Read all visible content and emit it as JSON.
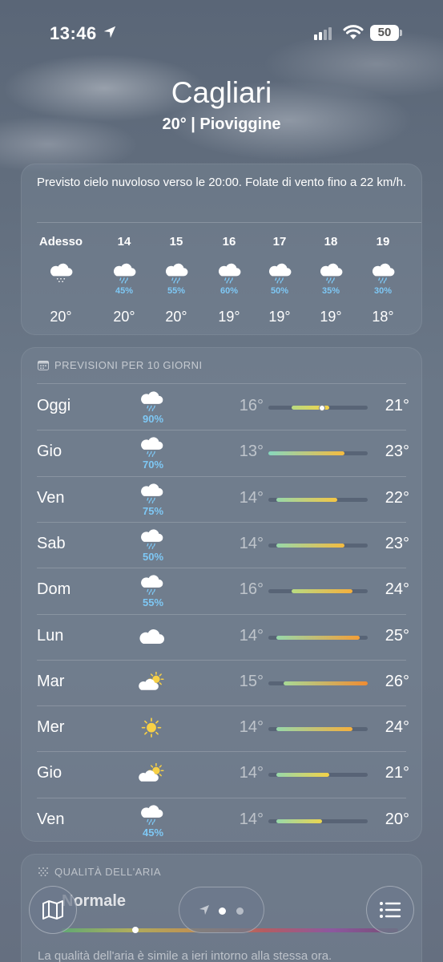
{
  "status": {
    "time": "13:46",
    "battery": "50"
  },
  "header": {
    "city": "Cagliari",
    "summary": "20°  |  Pioviggine"
  },
  "hourly": {
    "description": "Previsto cielo nuvoloso verso le 20:00. Folate di vento fino a 22 km/h.",
    "items": [
      {
        "label": "Adesso",
        "icon": "cloud-drizzle-icon",
        "pct": "",
        "temp": "20°"
      },
      {
        "label": "14",
        "icon": "cloud-rain-icon",
        "pct": "45%",
        "temp": "20°"
      },
      {
        "label": "15",
        "icon": "cloud-rain-icon",
        "pct": "55%",
        "temp": "20°"
      },
      {
        "label": "16",
        "icon": "cloud-rain-icon",
        "pct": "60%",
        "temp": "19°"
      },
      {
        "label": "17",
        "icon": "cloud-rain-icon",
        "pct": "50%",
        "temp": "19°"
      },
      {
        "label": "18",
        "icon": "cloud-rain-icon",
        "pct": "35%",
        "temp": "19°"
      },
      {
        "label": "19",
        "icon": "cloud-rain-icon",
        "pct": "30%",
        "temp": "18°"
      }
    ]
  },
  "daily": {
    "title": "PREVISIONI PER 10 GIORNI",
    "range": {
      "min": 13,
      "max": 26
    },
    "days": [
      {
        "name": "Oggi",
        "icon": "cloud-rain-icon",
        "pct": "90%",
        "min": "16°",
        "max": "21°",
        "lo": 16,
        "hi": 21,
        "current": 20
      },
      {
        "name": "Gio",
        "icon": "cloud-rain-icon",
        "pct": "70%",
        "min": "13°",
        "max": "23°",
        "lo": 13,
        "hi": 23
      },
      {
        "name": "Ven",
        "icon": "cloud-rain-icon",
        "pct": "75%",
        "min": "14°",
        "max": "22°",
        "lo": 14,
        "hi": 22
      },
      {
        "name": "Sab",
        "icon": "cloud-rain-icon",
        "pct": "50%",
        "min": "14°",
        "max": "23°",
        "lo": 14,
        "hi": 23
      },
      {
        "name": "Dom",
        "icon": "cloud-rain-icon",
        "pct": "55%",
        "min": "16°",
        "max": "24°",
        "lo": 16,
        "hi": 24
      },
      {
        "name": "Lun",
        "icon": "cloud-icon",
        "pct": "",
        "min": "14°",
        "max": "25°",
        "lo": 14,
        "hi": 25
      },
      {
        "name": "Mar",
        "icon": "partly-sunny-icon",
        "pct": "",
        "min": "15°",
        "max": "26°",
        "lo": 15,
        "hi": 26
      },
      {
        "name": "Mer",
        "icon": "sun-icon",
        "pct": "",
        "min": "14°",
        "max": "24°",
        "lo": 14,
        "hi": 24
      },
      {
        "name": "Gio",
        "icon": "partly-sunny-icon",
        "pct": "",
        "min": "14°",
        "max": "21°",
        "lo": 14,
        "hi": 21
      },
      {
        "name": "Ven",
        "icon": "cloud-rain-icon",
        "pct": "45%",
        "min": "14°",
        "max": "20°",
        "lo": 14,
        "hi": 20
      }
    ]
  },
  "air": {
    "title": "QUALITÀ DELL'ARIA",
    "value": "Normale",
    "text": "La qualità dell'aria è simile a ieri intorno alla stessa ora."
  },
  "colors": {
    "precip": "#7ec8f5",
    "sun": "#f7d046"
  }
}
